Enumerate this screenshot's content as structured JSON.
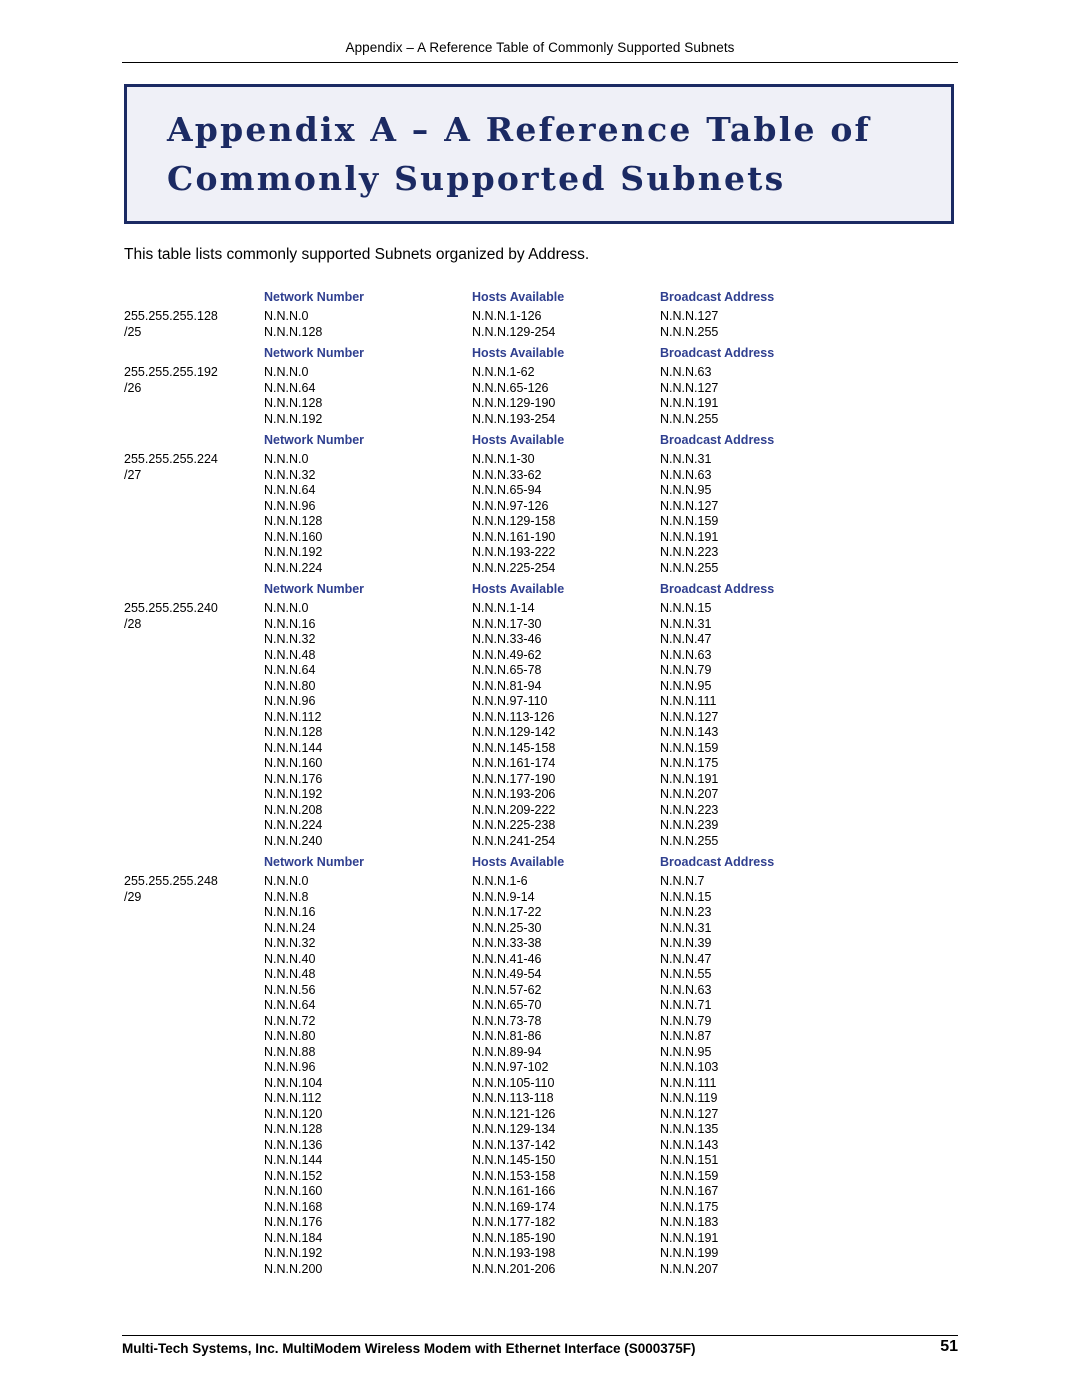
{
  "header": {
    "running_title": "Appendix – A Reference Table of Commonly Supported Subnets"
  },
  "title_box": {
    "line1": "Appendix A – A Reference Table of",
    "line2": "Commonly Supported Subnets",
    "border_color": "#1b2a63",
    "fill_color": "#eff0f7"
  },
  "intro": "This table lists commonly supported Subnets organized by Address.",
  "columns": {
    "network_number": "Network Number",
    "hosts_available": "Hosts Available",
    "broadcast_address": "Broadcast Address",
    "header_color": "#2f3f8f"
  },
  "blocks": [
    {
      "mask": "255.255.255.128",
      "cidr": "/25",
      "rows": [
        {
          "net": "N.N.N.0",
          "hosts": "N.N.N.1-126",
          "bcast": "N.N.N.127"
        },
        {
          "net": "N.N.N.128",
          "hosts": "N.N.N.129-254",
          "bcast": "N.N.N.255"
        }
      ]
    },
    {
      "mask": "255.255.255.192",
      "cidr": "/26",
      "rows": [
        {
          "net": "N.N.N.0",
          "hosts": "N.N.N.1-62",
          "bcast": "N.N.N.63"
        },
        {
          "net": "N.N.N.64",
          "hosts": "N.N.N.65-126",
          "bcast": "N.N.N.127"
        },
        {
          "net": "N.N.N.128",
          "hosts": "N.N.N.129-190",
          "bcast": "N.N.N.191"
        },
        {
          "net": "N.N.N.192",
          "hosts": "N.N.N.193-254",
          "bcast": "N.N.N.255"
        }
      ]
    },
    {
      "mask": "255.255.255.224",
      "cidr": "/27",
      "rows": [
        {
          "net": "N.N.N.0",
          "hosts": "N.N.N.1-30",
          "bcast": "N.N.N.31"
        },
        {
          "net": "N.N.N.32",
          "hosts": "N.N.N.33-62",
          "bcast": "N.N.N.63"
        },
        {
          "net": "N.N.N.64",
          "hosts": "N.N.N.65-94",
          "bcast": "N.N.N.95"
        },
        {
          "net": "N.N.N.96",
          "hosts": "N.N.N.97-126",
          "bcast": "N.N.N.127"
        },
        {
          "net": "N.N.N.128",
          "hosts": "N.N.N.129-158",
          "bcast": "N.N.N.159"
        },
        {
          "net": "N.N.N.160",
          "hosts": "N.N.N.161-190",
          "bcast": "N.N.N.191"
        },
        {
          "net": "N.N.N.192",
          "hosts": "N.N.N.193-222",
          "bcast": "N.N.N.223"
        },
        {
          "net": "N.N.N.224",
          "hosts": "N.N.N.225-254",
          "bcast": "N.N.N.255"
        }
      ]
    },
    {
      "mask": "255.255.255.240",
      "cidr": "/28",
      "rows": [
        {
          "net": "N.N.N.0",
          "hosts": "N.N.N.1-14",
          "bcast": "N.N.N.15"
        },
        {
          "net": "N.N.N.16",
          "hosts": "N.N.N.17-30",
          "bcast": "N.N.N.31"
        },
        {
          "net": "N.N.N.32",
          "hosts": "N.N.N.33-46",
          "bcast": "N.N.N.47"
        },
        {
          "net": "N.N.N.48",
          "hosts": "N.N.N.49-62",
          "bcast": "N.N.N.63"
        },
        {
          "net": "N.N.N.64",
          "hosts": "N.N.N.65-78",
          "bcast": "N.N.N.79"
        },
        {
          "net": "N.N.N.80",
          "hosts": "N.N.N.81-94",
          "bcast": "N.N.N.95"
        },
        {
          "net": "N.N.N.96",
          "hosts": "N.N.N.97-110",
          "bcast": "N.N.N.111"
        },
        {
          "net": "N.N.N.112",
          "hosts": "N.N.N.113-126",
          "bcast": "N.N.N.127"
        },
        {
          "net": "N.N.N.128",
          "hosts": "N.N.N.129-142",
          "bcast": "N.N.N.143"
        },
        {
          "net": "N.N.N.144",
          "hosts": "N.N.N.145-158",
          "bcast": "N.N.N.159"
        },
        {
          "net": "N.N.N.160",
          "hosts": "N.N.N.161-174",
          "bcast": "N.N.N.175"
        },
        {
          "net": "N.N.N.176",
          "hosts": "N.N.N.177-190",
          "bcast": "N.N.N.191"
        },
        {
          "net": "N.N.N.192",
          "hosts": "N.N.N.193-206",
          "bcast": "N.N.N.207"
        },
        {
          "net": "N.N.N.208",
          "hosts": "N.N.N.209-222",
          "bcast": "N.N.N.223"
        },
        {
          "net": "N.N.N.224",
          "hosts": "N.N.N.225-238",
          "bcast": "N.N.N.239"
        },
        {
          "net": "N.N.N.240",
          "hosts": "N.N.N.241-254",
          "bcast": "N.N.N.255"
        }
      ]
    },
    {
      "mask": "255.255.255.248",
      "cidr": "/29",
      "rows": [
        {
          "net": "N.N.N.0",
          "hosts": "N.N.N.1-6",
          "bcast": "N.N.N.7"
        },
        {
          "net": "N.N.N.8",
          "hosts": "N.N.N.9-14",
          "bcast": "N.N.N.15"
        },
        {
          "net": "N.N.N.16",
          "hosts": "N.N.N.17-22",
          "bcast": "N.N.N.23"
        },
        {
          "net": "N.N.N.24",
          "hosts": "N.N.N.25-30",
          "bcast": "N.N.N.31"
        },
        {
          "net": "N.N.N.32",
          "hosts": "N.N.N.33-38",
          "bcast": "N.N.N.39"
        },
        {
          "net": "N.N.N.40",
          "hosts": "N.N.N.41-46",
          "bcast": "N.N.N.47"
        },
        {
          "net": "N.N.N.48",
          "hosts": "N.N.N.49-54",
          "bcast": "N.N.N.55"
        },
        {
          "net": "N.N.N.56",
          "hosts": "N.N.N.57-62",
          "bcast": "N.N.N.63"
        },
        {
          "net": "N.N.N.64",
          "hosts": "N.N.N.65-70",
          "bcast": "N.N.N.71"
        },
        {
          "net": "N.N.N.72",
          "hosts": "N.N.N.73-78",
          "bcast": "N.N.N.79"
        },
        {
          "net": "N.N.N.80",
          "hosts": "N.N.N.81-86",
          "bcast": "N.N.N.87"
        },
        {
          "net": "N.N.N.88",
          "hosts": "N.N.N.89-94",
          "bcast": "N.N.N.95"
        },
        {
          "net": "N.N.N.96",
          "hosts": "N.N.N.97-102",
          "bcast": "N.N.N.103"
        },
        {
          "net": "N.N.N.104",
          "hosts": "N.N.N.105-110",
          "bcast": "N.N.N.111"
        },
        {
          "net": "N.N.N.112",
          "hosts": "N.N.N.113-118",
          "bcast": "N.N.N.119"
        },
        {
          "net": "N.N.N.120",
          "hosts": "N.N.N.121-126",
          "bcast": "N.N.N.127"
        },
        {
          "net": "N.N.N.128",
          "hosts": "N.N.N.129-134",
          "bcast": "N.N.N.135"
        },
        {
          "net": "N.N.N.136",
          "hosts": "N.N.N.137-142",
          "bcast": "N.N.N.143"
        },
        {
          "net": "N.N.N.144",
          "hosts": "N.N.N.145-150",
          "bcast": "N.N.N.151"
        },
        {
          "net": "N.N.N.152",
          "hosts": "N.N.N.153-158",
          "bcast": "N.N.N.159"
        },
        {
          "net": "N.N.N.160",
          "hosts": "N.N.N.161-166",
          "bcast": "N.N.N.167"
        },
        {
          "net": "N.N.N.168",
          "hosts": "N.N.N.169-174",
          "bcast": "N.N.N.175"
        },
        {
          "net": "N.N.N.176",
          "hosts": "N.N.N.177-182",
          "bcast": "N.N.N.183"
        },
        {
          "net": "N.N.N.184",
          "hosts": "N.N.N.185-190",
          "bcast": "N.N.N.191"
        },
        {
          "net": "N.N.N.192",
          "hosts": "N.N.N.193-198",
          "bcast": "N.N.N.199"
        },
        {
          "net": "N.N.N.200",
          "hosts": "N.N.N.201-206",
          "bcast": "N.N.N.207"
        }
      ]
    }
  ],
  "footer": {
    "text": "Multi-Tech Systems, Inc. MultiModem Wireless Modem with Ethernet Interface (S000375F)",
    "page_number": "51"
  }
}
